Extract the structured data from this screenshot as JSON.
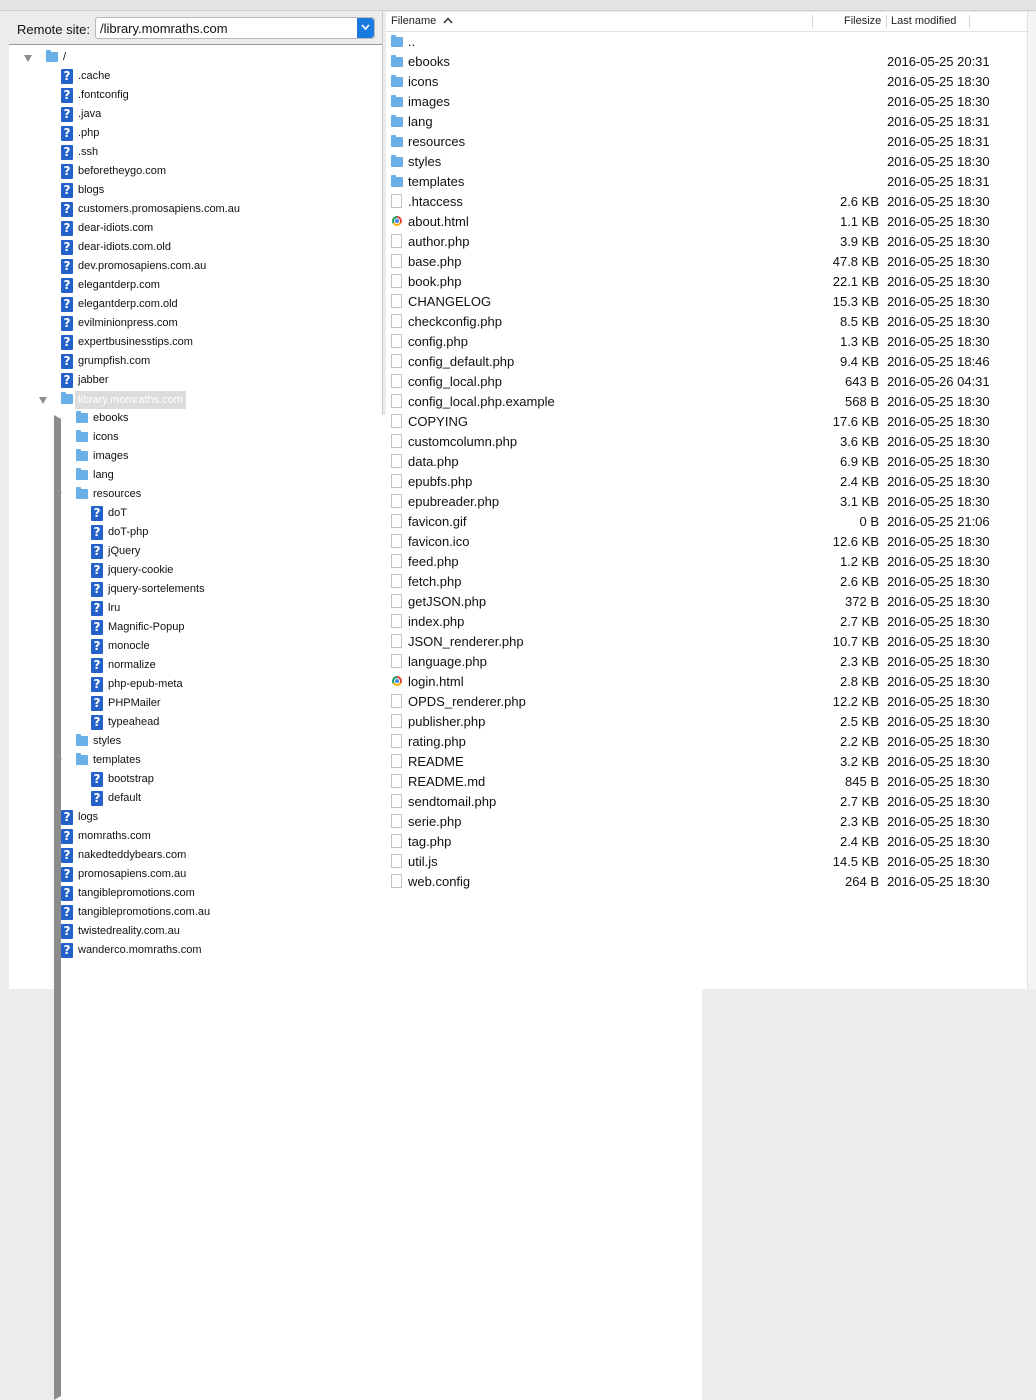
{
  "remote": {
    "label": "Remote site:",
    "path": "/library.momraths.com"
  },
  "tree": [
    {
      "name": "/",
      "icon": "folder",
      "depth": 0,
      "expander": "expanded"
    },
    {
      "name": ".cache",
      "icon": "unknown",
      "depth": 1
    },
    {
      "name": ".fontconfig",
      "icon": "unknown",
      "depth": 1
    },
    {
      "name": ".java",
      "icon": "unknown",
      "depth": 1
    },
    {
      "name": ".php",
      "icon": "unknown",
      "depth": 1
    },
    {
      "name": ".ssh",
      "icon": "unknown",
      "depth": 1
    },
    {
      "name": "beforetheygo.com",
      "icon": "unknown",
      "depth": 1
    },
    {
      "name": "blogs",
      "icon": "unknown",
      "depth": 1
    },
    {
      "name": "customers.promosapiens.com.au",
      "icon": "unknown",
      "depth": 1
    },
    {
      "name": "dear-idiots.com",
      "icon": "unknown",
      "depth": 1
    },
    {
      "name": "dear-idiots.com.old",
      "icon": "unknown",
      "depth": 1
    },
    {
      "name": "dev.promosapiens.com.au",
      "icon": "unknown",
      "depth": 1
    },
    {
      "name": "elegantderp.com",
      "icon": "unknown",
      "depth": 1
    },
    {
      "name": "elegantderp.com.old",
      "icon": "unknown",
      "depth": 1
    },
    {
      "name": "evilminionpress.com",
      "icon": "unknown",
      "depth": 1
    },
    {
      "name": "expertbusinesstips.com",
      "icon": "unknown",
      "depth": 1
    },
    {
      "name": "grumpfish.com",
      "icon": "unknown",
      "depth": 1
    },
    {
      "name": "jabber",
      "icon": "unknown",
      "depth": 1
    },
    {
      "name": "library.momraths.com",
      "icon": "folder",
      "depth": 1,
      "expander": "expanded",
      "selected": true
    },
    {
      "name": "ebooks",
      "icon": "folder",
      "depth": 2,
      "expander": "collapsed"
    },
    {
      "name": "icons",
      "icon": "folder",
      "depth": 2
    },
    {
      "name": "images",
      "icon": "folder",
      "depth": 2
    },
    {
      "name": "lang",
      "icon": "folder",
      "depth": 2
    },
    {
      "name": "resources",
      "icon": "folder",
      "depth": 2,
      "expander": "expanded"
    },
    {
      "name": "doT",
      "icon": "unknown",
      "depth": 3
    },
    {
      "name": "doT-php",
      "icon": "unknown",
      "depth": 3
    },
    {
      "name": "jQuery",
      "icon": "unknown",
      "depth": 3
    },
    {
      "name": "jquery-cookie",
      "icon": "unknown",
      "depth": 3
    },
    {
      "name": "jquery-sortelements",
      "icon": "unknown",
      "depth": 3
    },
    {
      "name": "lru",
      "icon": "unknown",
      "depth": 3
    },
    {
      "name": "Magnific-Popup",
      "icon": "unknown",
      "depth": 3
    },
    {
      "name": "monocle",
      "icon": "unknown",
      "depth": 3
    },
    {
      "name": "normalize",
      "icon": "unknown",
      "depth": 3
    },
    {
      "name": "php-epub-meta",
      "icon": "unknown",
      "depth": 3
    },
    {
      "name": "PHPMailer",
      "icon": "unknown",
      "depth": 3
    },
    {
      "name": "typeahead",
      "icon": "unknown",
      "depth": 3
    },
    {
      "name": "styles",
      "icon": "folder",
      "depth": 2
    },
    {
      "name": "templates",
      "icon": "folder",
      "depth": 2,
      "expander": "expanded"
    },
    {
      "name": "bootstrap",
      "icon": "unknown",
      "depth": 3
    },
    {
      "name": "default",
      "icon": "unknown",
      "depth": 3
    },
    {
      "name": "logs",
      "icon": "unknown",
      "depth": 1
    },
    {
      "name": "momraths.com",
      "icon": "unknown",
      "depth": 1
    },
    {
      "name": "nakedteddybears.com",
      "icon": "unknown",
      "depth": 1
    },
    {
      "name": "promosapiens.com.au",
      "icon": "unknown",
      "depth": 1
    },
    {
      "name": "tangiblepromotions.com",
      "icon": "unknown",
      "depth": 1
    },
    {
      "name": "tangiblepromotions.com.au",
      "icon": "unknown",
      "depth": 1
    },
    {
      "name": "twistedreality.com.au",
      "icon": "unknown",
      "depth": 1
    },
    {
      "name": "wanderco.momraths.com",
      "icon": "unknown",
      "depth": 1
    }
  ],
  "list": {
    "headers": {
      "filename": "Filename",
      "filesize": "Filesize",
      "modified": "Last modified",
      "sort_indicator": "chevron-up-icon"
    },
    "rows": [
      {
        "name": "..",
        "icon": "folder",
        "size": "",
        "modified": ""
      },
      {
        "name": "ebooks",
        "icon": "folder",
        "size": "",
        "modified": "2016-05-25 20:31"
      },
      {
        "name": "icons",
        "icon": "folder",
        "size": "",
        "modified": "2016-05-25 18:30"
      },
      {
        "name": "images",
        "icon": "folder",
        "size": "",
        "modified": "2016-05-25 18:30"
      },
      {
        "name": "lang",
        "icon": "folder",
        "size": "",
        "modified": "2016-05-25 18:31"
      },
      {
        "name": "resources",
        "icon": "folder",
        "size": "",
        "modified": "2016-05-25 18:31"
      },
      {
        "name": "styles",
        "icon": "folder",
        "size": "",
        "modified": "2016-05-25 18:30"
      },
      {
        "name": "templates",
        "icon": "folder",
        "size": "",
        "modified": "2016-05-25 18:31"
      },
      {
        "name": ".htaccess",
        "icon": "file",
        "size": "2.6 KB",
        "modified": "2016-05-25 18:30"
      },
      {
        "name": "about.html",
        "icon": "chrome",
        "size": "1.1 KB",
        "modified": "2016-05-25 18:30"
      },
      {
        "name": "author.php",
        "icon": "file",
        "size": "3.9 KB",
        "modified": "2016-05-25 18:30"
      },
      {
        "name": "base.php",
        "icon": "file",
        "size": "47.8 KB",
        "modified": "2016-05-25 18:30"
      },
      {
        "name": "book.php",
        "icon": "file",
        "size": "22.1 KB",
        "modified": "2016-05-25 18:30"
      },
      {
        "name": "CHANGELOG",
        "icon": "file",
        "size": "15.3 KB",
        "modified": "2016-05-25 18:30"
      },
      {
        "name": "checkconfig.php",
        "icon": "file",
        "size": "8.5 KB",
        "modified": "2016-05-25 18:30"
      },
      {
        "name": "config.php",
        "icon": "file",
        "size": "1.3 KB",
        "modified": "2016-05-25 18:30"
      },
      {
        "name": "config_default.php",
        "icon": "file",
        "size": "9.4 KB",
        "modified": "2016-05-25 18:46"
      },
      {
        "name": "config_local.php",
        "icon": "file",
        "size": "643 B",
        "modified": "2016-05-26 04:31"
      },
      {
        "name": "config_local.php.example",
        "icon": "file",
        "size": "568 B",
        "modified": "2016-05-25 18:30"
      },
      {
        "name": "COPYING",
        "icon": "file",
        "size": "17.6 KB",
        "modified": "2016-05-25 18:30"
      },
      {
        "name": "customcolumn.php",
        "icon": "file",
        "size": "3.6 KB",
        "modified": "2016-05-25 18:30"
      },
      {
        "name": "data.php",
        "icon": "file",
        "size": "6.9 KB",
        "modified": "2016-05-25 18:30"
      },
      {
        "name": "epubfs.php",
        "icon": "file",
        "size": "2.4 KB",
        "modified": "2016-05-25 18:30"
      },
      {
        "name": "epubreader.php",
        "icon": "file",
        "size": "3.1 KB",
        "modified": "2016-05-25 18:30"
      },
      {
        "name": "favicon.gif",
        "icon": "file",
        "size": "0 B",
        "modified": "2016-05-25 21:06"
      },
      {
        "name": "favicon.ico",
        "icon": "file",
        "size": "12.6 KB",
        "modified": "2016-05-25 18:30"
      },
      {
        "name": "feed.php",
        "icon": "file",
        "size": "1.2 KB",
        "modified": "2016-05-25 18:30"
      },
      {
        "name": "fetch.php",
        "icon": "file",
        "size": "2.6 KB",
        "modified": "2016-05-25 18:30"
      },
      {
        "name": "getJSON.php",
        "icon": "file",
        "size": "372 B",
        "modified": "2016-05-25 18:30"
      },
      {
        "name": "index.php",
        "icon": "file",
        "size": "2.7 KB",
        "modified": "2016-05-25 18:30"
      },
      {
        "name": "JSON_renderer.php",
        "icon": "file",
        "size": "10.7 KB",
        "modified": "2016-05-25 18:30"
      },
      {
        "name": "language.php",
        "icon": "file",
        "size": "2.3 KB",
        "modified": "2016-05-25 18:30"
      },
      {
        "name": "login.html",
        "icon": "chrome",
        "size": "2.8 KB",
        "modified": "2016-05-25 18:30"
      },
      {
        "name": "OPDS_renderer.php",
        "icon": "file",
        "size": "12.2 KB",
        "modified": "2016-05-25 18:30"
      },
      {
        "name": "publisher.php",
        "icon": "file",
        "size": "2.5 KB",
        "modified": "2016-05-25 18:30"
      },
      {
        "name": "rating.php",
        "icon": "file",
        "size": "2.2 KB",
        "modified": "2016-05-25 18:30"
      },
      {
        "name": "README",
        "icon": "file",
        "size": "3.2 KB",
        "modified": "2016-05-25 18:30"
      },
      {
        "name": "README.md",
        "icon": "file",
        "size": "845 B",
        "modified": "2016-05-25 18:30"
      },
      {
        "name": "sendtomail.php",
        "icon": "file",
        "size": "2.7 KB",
        "modified": "2016-05-25 18:30"
      },
      {
        "name": "serie.php",
        "icon": "file",
        "size": "2.3 KB",
        "modified": "2016-05-25 18:30"
      },
      {
        "name": "tag.php",
        "icon": "file",
        "size": "2.4 KB",
        "modified": "2016-05-25 18:30"
      },
      {
        "name": "util.js",
        "icon": "file",
        "size": "14.5 KB",
        "modified": "2016-05-25 18:30"
      },
      {
        "name": "web.config",
        "icon": "file",
        "size": "264 B",
        "modified": "2016-05-25 18:30"
      }
    ]
  },
  "colors": {
    "folder": "#6aaee8",
    "unknown_icon": "#2461c8",
    "combo_button": "#1a7ae0",
    "selection": "#dcdcdc"
  }
}
